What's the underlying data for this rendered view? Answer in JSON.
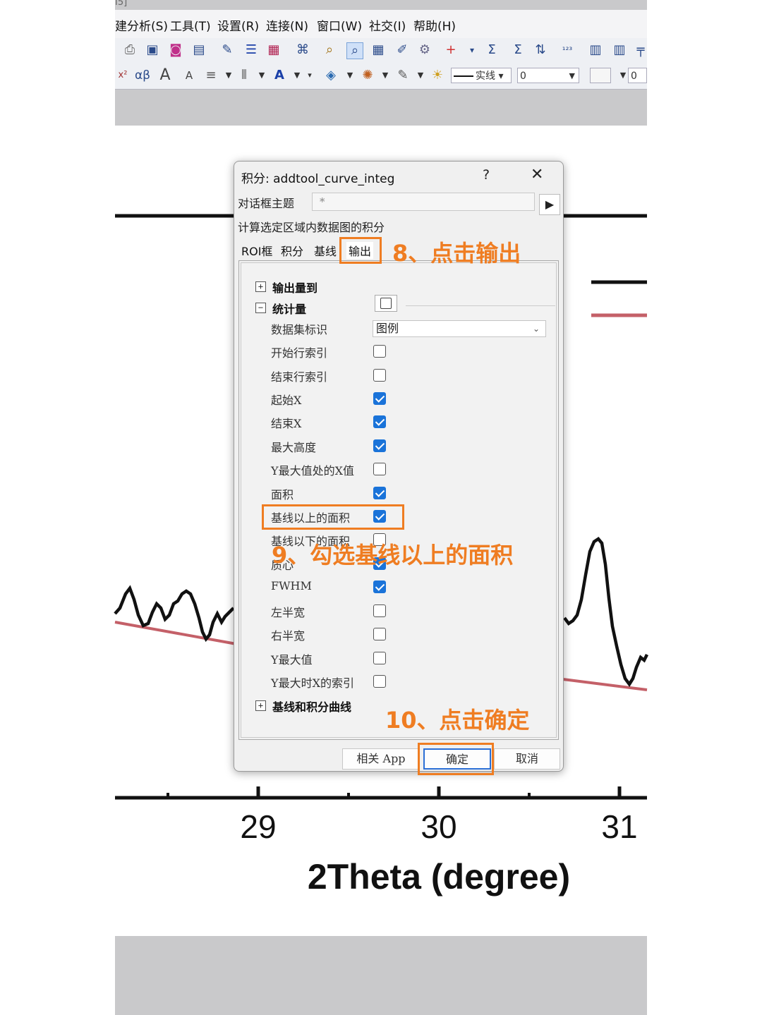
{
  "topbar": {
    "cut_text": "I5]",
    "menu": [
      "建分析(S)",
      "工具(T)",
      "设置(R)",
      "连接(N)",
      "窗口(W)",
      "社交(I)",
      "帮助(H)"
    ],
    "toolbar2": {
      "alpha_beta": "αβ",
      "line_style": "实线",
      "width_value": "0",
      "second_value": "0"
    }
  },
  "dialog": {
    "title": "积分: addtool_curve_integ",
    "help": "?",
    "close": "✕",
    "theme_label": "对话框主题",
    "theme_value": "*",
    "description": "计算选定区域内数据图的积分",
    "tabs": [
      "ROI框",
      "积分",
      "基线",
      "输出"
    ],
    "active_tab": "输出",
    "tree": {
      "output_to": "输出量到",
      "stats": "统计量",
      "dataset_label": "数据集标识",
      "dataset_value": "图例",
      "rows": [
        {
          "label": "开始行索引",
          "checked": false
        },
        {
          "label": "结束行索引",
          "checked": false
        },
        {
          "label": "起始X",
          "checked": true
        },
        {
          "label": "结束X",
          "checked": true
        },
        {
          "label": "最大高度",
          "checked": true
        },
        {
          "label": "Y最大值处的X值",
          "checked": false
        },
        {
          "label": "面积",
          "checked": true
        },
        {
          "label": "基线以上的面积",
          "checked": true
        },
        {
          "label": "基线以下的面积",
          "checked": false
        },
        {
          "label": "质心",
          "checked": true
        },
        {
          "label": "FWHM",
          "checked": true
        },
        {
          "label": "左半宽",
          "checked": false
        },
        {
          "label": "右半宽",
          "checked": false
        },
        {
          "label": "Y最大值",
          "checked": false
        },
        {
          "label": "Y最大时X的索引",
          "checked": false
        }
      ],
      "curves": "基线和积分曲线"
    },
    "buttons": {
      "app": "相关 App",
      "ok": "确定",
      "cancel": "取消"
    }
  },
  "annotations": {
    "step8": "8、点击输出",
    "step9": "9、勾选基线以上的面积",
    "step10": "10、点击确定",
    "color": "#ef7d22"
  },
  "plot": {
    "x_ticks": [
      "29",
      "30",
      "31"
    ],
    "xlabel": "2Theta (degree)"
  }
}
